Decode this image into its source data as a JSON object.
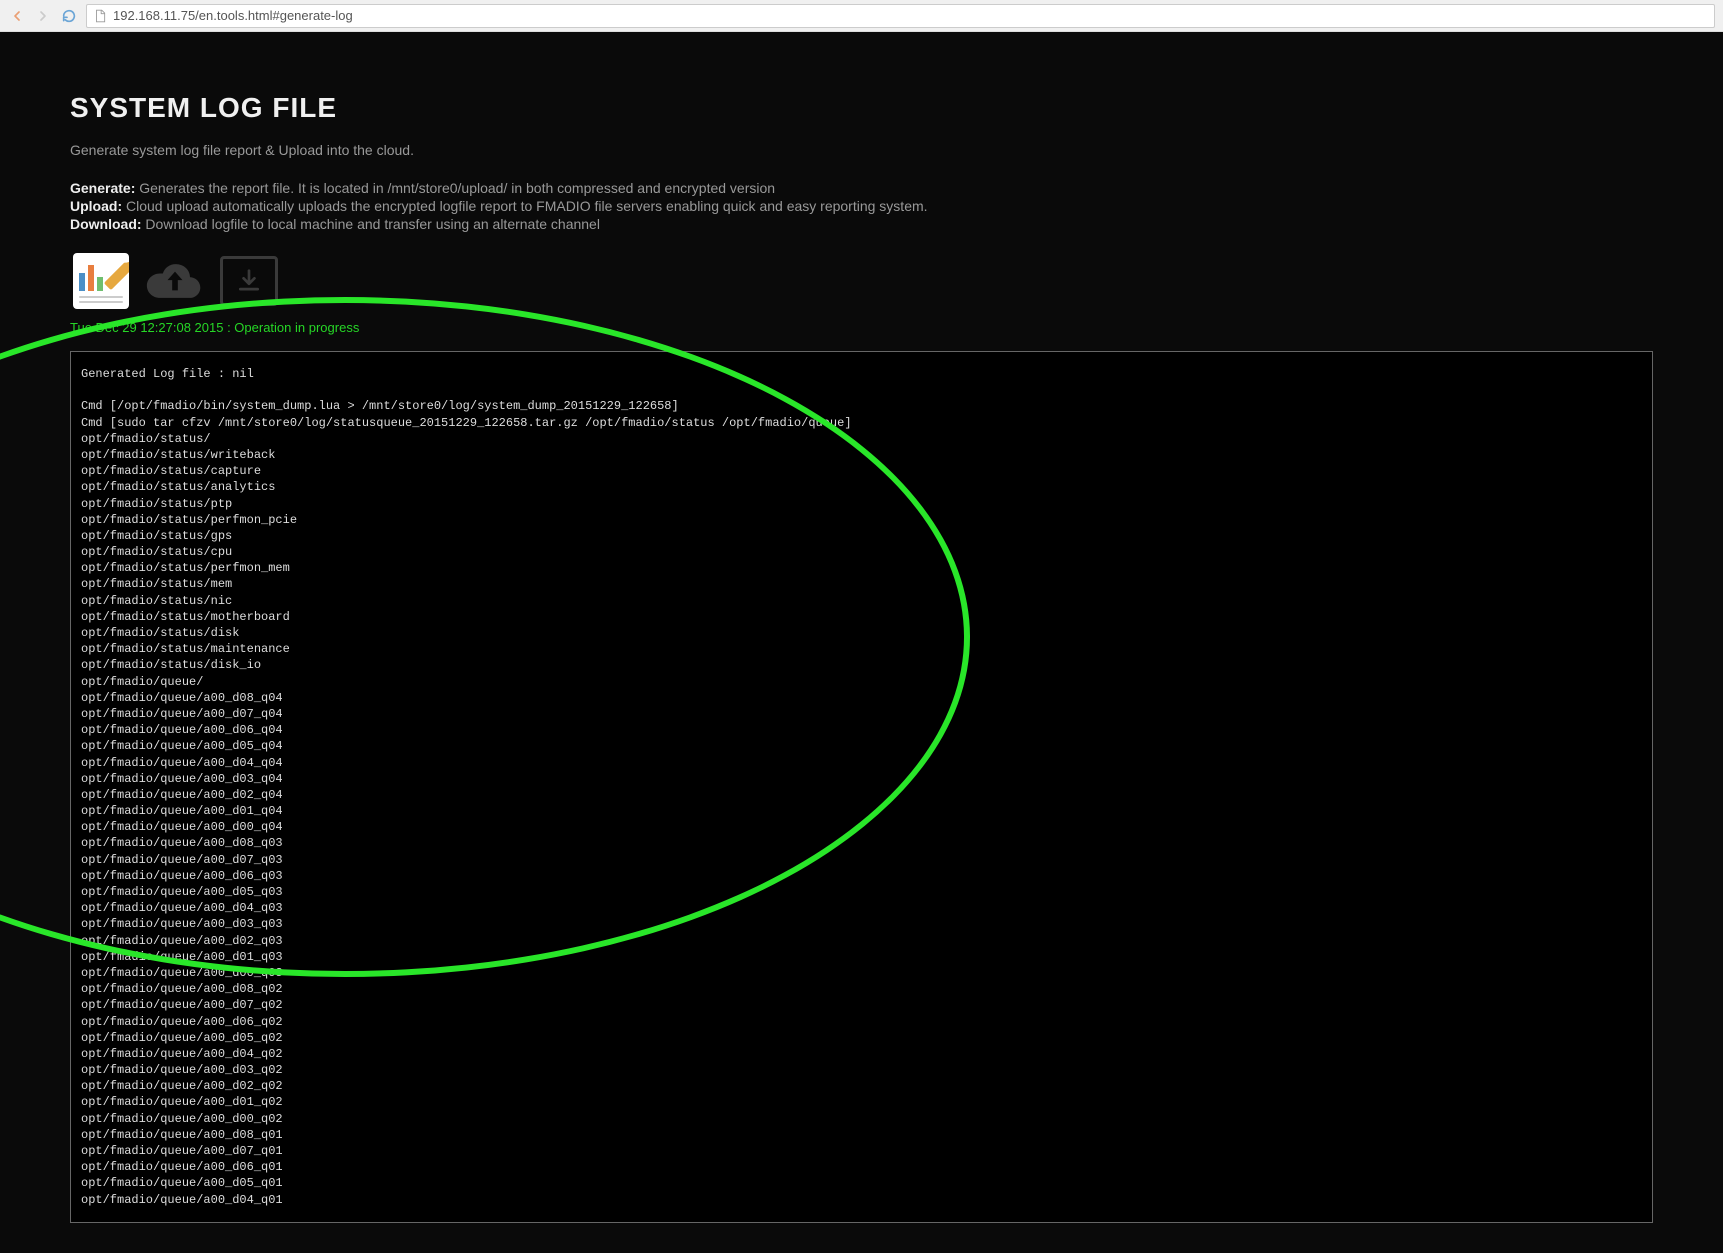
{
  "url": "192.168.11.75/en.tools.html#generate-log",
  "page": {
    "title": "SYSTEM LOG FILE",
    "subtitle": "Generate system log file report & Upload into the cloud.",
    "info": {
      "generate_label": "Generate:",
      "generate_text": " Generates the report file. It is located in /mnt/store0/upload/ in both compressed and encrypted version",
      "upload_label": "Upload:",
      "upload_text": " Cloud upload automatically uploads the encrypted logfile report to FMADIO file servers enabling quick and easy reporting system.",
      "download_label": "Download:",
      "download_text": " Download logfile to local machine and transfer using an alternate channel"
    },
    "status": "Tue Dec 29 12:27:08 2015 : Operation in progress",
    "log": "Generated Log file : nil\n\nCmd [/opt/fmadio/bin/system_dump.lua > /mnt/store0/log/system_dump_20151229_122658]\nCmd [sudo tar cfzv /mnt/store0/log/statusqueue_20151229_122658.tar.gz /opt/fmadio/status /opt/fmadio/queue]\nopt/fmadio/status/\nopt/fmadio/status/writeback\nopt/fmadio/status/capture\nopt/fmadio/status/analytics\nopt/fmadio/status/ptp\nopt/fmadio/status/perfmon_pcie\nopt/fmadio/status/gps\nopt/fmadio/status/cpu\nopt/fmadio/status/perfmon_mem\nopt/fmadio/status/mem\nopt/fmadio/status/nic\nopt/fmadio/status/motherboard\nopt/fmadio/status/disk\nopt/fmadio/status/maintenance\nopt/fmadio/status/disk_io\nopt/fmadio/queue/\nopt/fmadio/queue/a00_d08_q04\nopt/fmadio/queue/a00_d07_q04\nopt/fmadio/queue/a00_d06_q04\nopt/fmadio/queue/a00_d05_q04\nopt/fmadio/queue/a00_d04_q04\nopt/fmadio/queue/a00_d03_q04\nopt/fmadio/queue/a00_d02_q04\nopt/fmadio/queue/a00_d01_q04\nopt/fmadio/queue/a00_d00_q04\nopt/fmadio/queue/a00_d08_q03\nopt/fmadio/queue/a00_d07_q03\nopt/fmadio/queue/a00_d06_q03\nopt/fmadio/queue/a00_d05_q03\nopt/fmadio/queue/a00_d04_q03\nopt/fmadio/queue/a00_d03_q03\nopt/fmadio/queue/a00_d02_q03\nopt/fmadio/queue/a00_d01_q03\nopt/fmadio/queue/a00_d00_q03\nopt/fmadio/queue/a00_d08_q02\nopt/fmadio/queue/a00_d07_q02\nopt/fmadio/queue/a00_d06_q02\nopt/fmadio/queue/a00_d05_q02\nopt/fmadio/queue/a00_d04_q02\nopt/fmadio/queue/a00_d03_q02\nopt/fmadio/queue/a00_d02_q02\nopt/fmadio/queue/a00_d01_q02\nopt/fmadio/queue/a00_d00_q02\nopt/fmadio/queue/a00_d08_q01\nopt/fmadio/queue/a00_d07_q01\nopt/fmadio/queue/a00_d06_q01\nopt/fmadio/queue/a00_d05_q01\nopt/fmadio/queue/a00_d04_q01"
  }
}
